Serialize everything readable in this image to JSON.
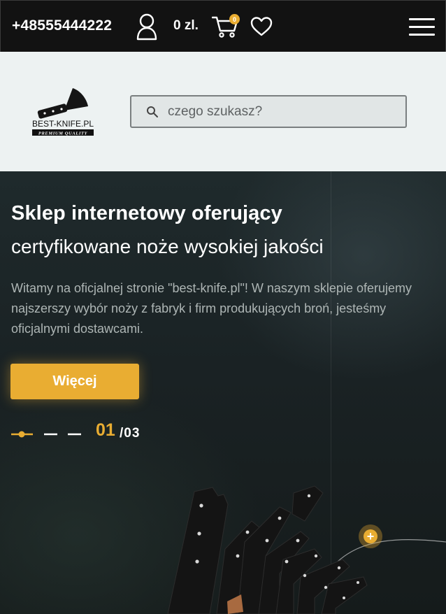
{
  "topbar": {
    "phone": "+48555444222",
    "cart_total": "0 zl.",
    "cart_count": "0",
    "icons": [
      "user-icon",
      "cart-icon",
      "heart-icon",
      "menu-icon"
    ]
  },
  "header": {
    "logo": {
      "name": "BEST-KNIFE.PL",
      "tagline": "PREMIUM QUALITY"
    },
    "search": {
      "placeholder": "czego szukasz?",
      "value": ""
    }
  },
  "hero": {
    "title": "Sklep internetowy oferujący",
    "subtitle": "certyfikowane noże wysokiej jakości",
    "text": "Witamy na oficjalnej stronie \"best-knife.pl\"! W naszym sklepie oferujemy najszerszy wybór noży z fabryk i firm produkujących broń, jesteśmy oficjalnymi dostawcami.",
    "button_label": "Więcej",
    "slide_current": "01",
    "slide_total": "/03",
    "hotspot_label": "+"
  },
  "colors": {
    "accent": "#e9ad32",
    "topbar_bg": "#121212",
    "header_bg": "#edf2f2"
  }
}
